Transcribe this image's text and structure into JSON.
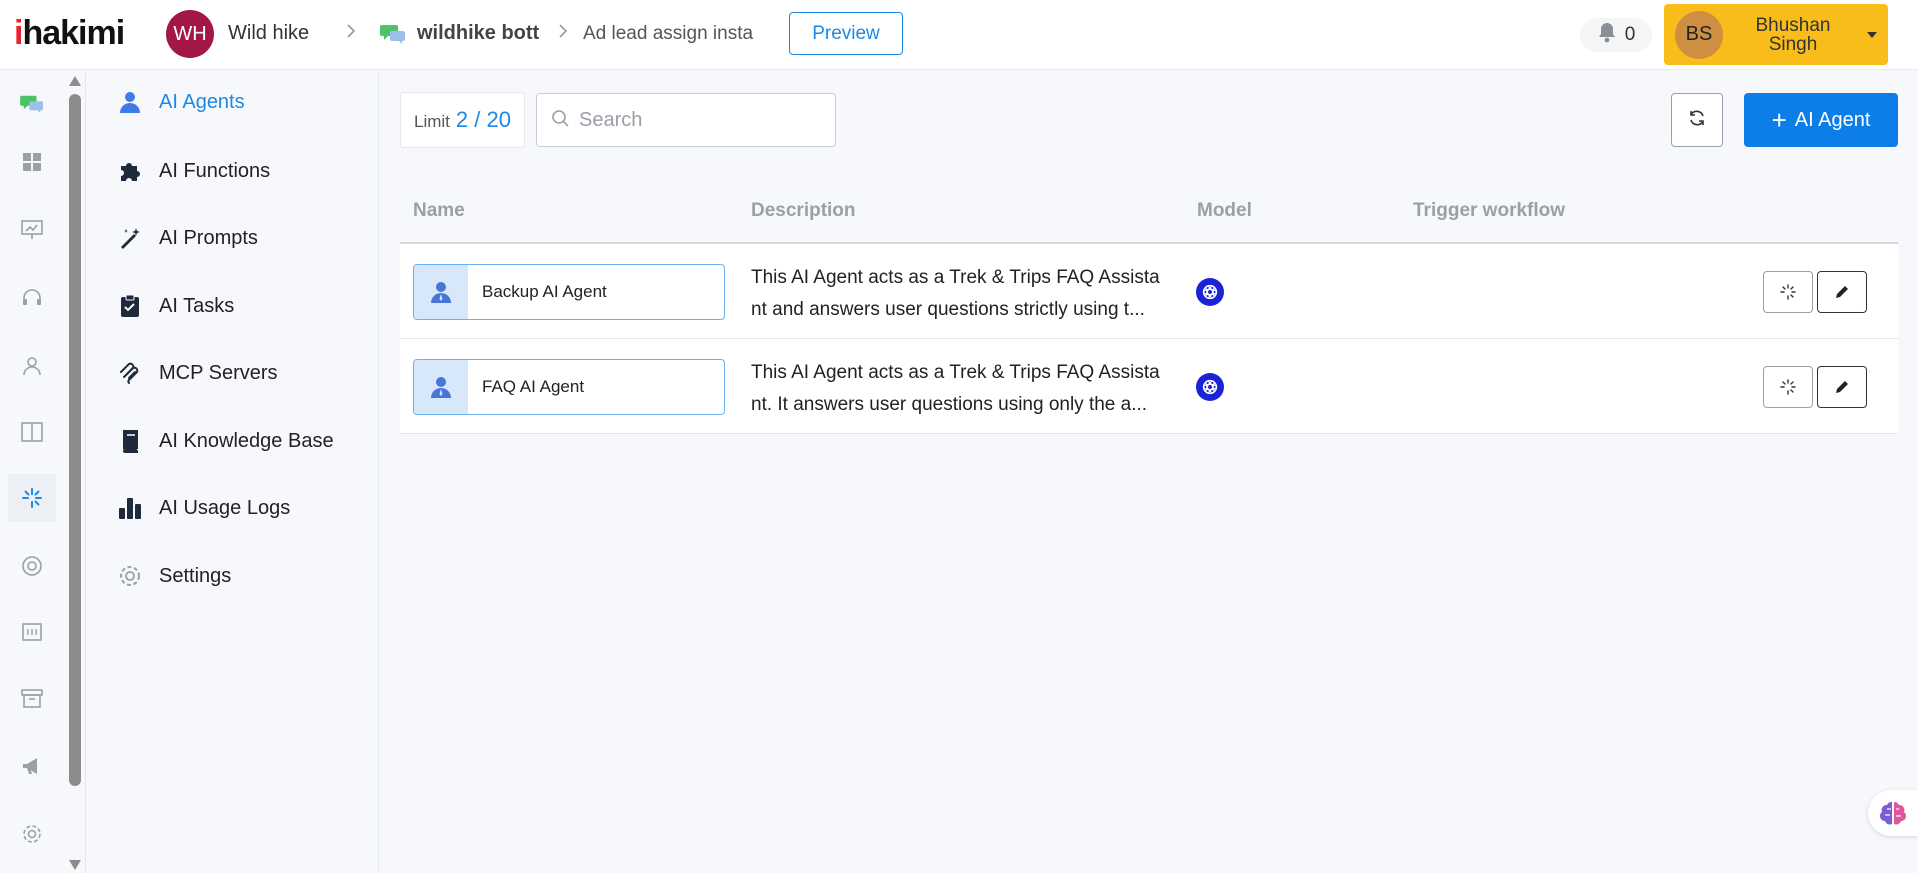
{
  "header": {
    "logo_prefix": "i",
    "logo_rest": "hakimi",
    "workspace_initials": "WH",
    "workspace_name": "Wild hike",
    "bot_name": "wildhike bott",
    "flow_name": "Ad lead assign insta",
    "preview_label": "Preview",
    "notification_count": "0",
    "user_initials": "BS",
    "user_name": "Bhushan Singh"
  },
  "rail": {
    "icons": [
      "chat-bubbles-icon",
      "dashboard-icon",
      "presentation-icon",
      "headset-icon",
      "contacts-icon",
      "columns-icon",
      "ai-sparkle-icon",
      "lifebuoy-icon",
      "form-icon",
      "archive-icon",
      "megaphone-icon",
      "settings-icon"
    ],
    "active": "ai-sparkle-icon"
  },
  "subnav": {
    "items": [
      {
        "label": "AI Agents",
        "icon": "agent-icon",
        "active": true
      },
      {
        "label": "AI Functions",
        "icon": "puzzle-icon"
      },
      {
        "label": "AI Prompts",
        "icon": "magic-wand-icon"
      },
      {
        "label": "AI Tasks",
        "icon": "clipboard-icon"
      },
      {
        "label": "MCP Servers",
        "icon": "mcp-icon"
      },
      {
        "label": "AI Knowledge Base",
        "icon": "book-icon"
      },
      {
        "label": "AI Usage Logs",
        "icon": "bar-chart-icon"
      },
      {
        "label": "Settings",
        "icon": "gear-icon"
      }
    ]
  },
  "toolbar": {
    "limit_label": "Limit",
    "limit_value": "2 / 20",
    "search_placeholder": "Search",
    "add_label": "AI Agent"
  },
  "table": {
    "columns": [
      "Name",
      "Description",
      "Model",
      "Trigger workflow"
    ],
    "rows": [
      {
        "name": "Backup AI Agent",
        "desc_line1": "This AI Agent acts as a Trek & Trips FAQ Assista",
        "desc_line2": "nt and answers user questions strictly using t...",
        "model": "openai-icon"
      },
      {
        "name": "FAQ AI Agent",
        "desc_line1": "This AI Agent acts as a Trek & Trips FAQ Assista",
        "desc_line2": "nt. It answers user questions using only the a...",
        "model": "openai-icon"
      }
    ]
  },
  "colors": {
    "accent": "#1e88e5",
    "primary_button": "#0d7de8",
    "user_pill": "#f8bd1a",
    "workspace_avatar": "#a31745"
  }
}
